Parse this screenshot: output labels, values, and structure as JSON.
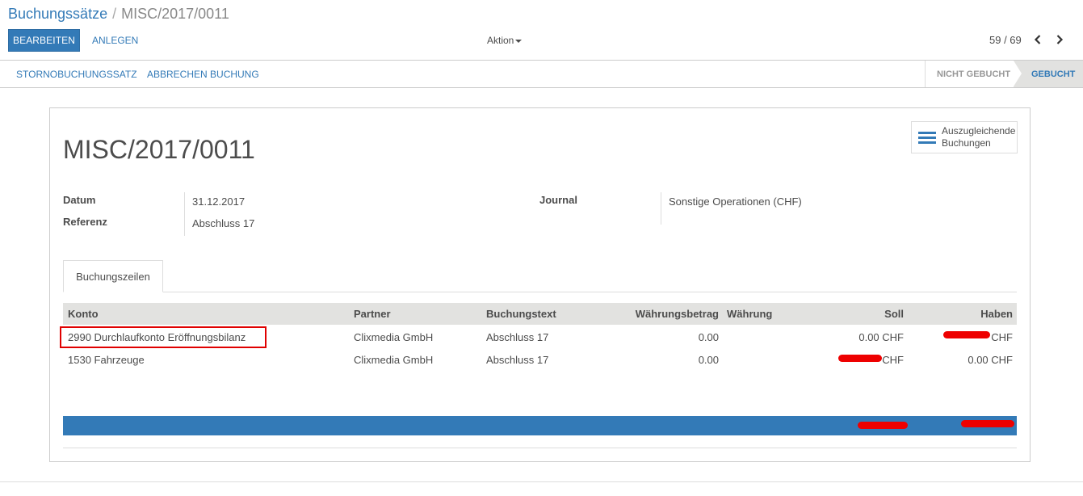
{
  "breadcrumb": {
    "parent": "Buchungssätze",
    "separator": "/",
    "current": "MISC/2017/0011"
  },
  "toolbar": {
    "edit_label": "BEARBEITEN",
    "create_label": "ANLEGEN",
    "action_label": "Aktion"
  },
  "pager": {
    "value": "59 / 69"
  },
  "statusbar": {
    "buttons": [
      "STORNOBUCHUNGSSATZ",
      "ABBRECHEN BUCHUNG"
    ],
    "states": [
      "NICHT GEBUCHT",
      "GEBUCHT"
    ],
    "active_state": "GEBUCHT"
  },
  "smart_button": {
    "line1": "Auszugleichende",
    "line2": "Buchungen"
  },
  "record": {
    "title": "MISC/2017/0011",
    "fields": {
      "datum_label": "Datum",
      "datum_value": "31.12.2017",
      "referenz_label": "Referenz",
      "referenz_value": "Abschluss 17",
      "journal_label": "Journal",
      "journal_value": "Sonstige Operationen (CHF)"
    }
  },
  "tabs": [
    "Buchungszeilen"
  ],
  "table": {
    "columns": [
      "Konto",
      "Partner",
      "Buchungstext",
      "Währungsbetrag",
      "Währung",
      "Soll",
      "Haben"
    ],
    "rows": [
      {
        "konto": "2990 Durchlaufkonto Eröffnungsbilanz",
        "partner": "Clixmedia GmbH",
        "text": "Abschluss 17",
        "betrag": "0.00",
        "waehrung": "",
        "soll": "0.00 CHF",
        "haben": "CHF"
      },
      {
        "konto": "1530 Fahrzeuge",
        "partner": "Clixmedia GmbH",
        "text": "Abschluss 17",
        "betrag": "0.00",
        "waehrung": "",
        "soll": "CHF",
        "haben": "0.00 CHF"
      }
    ]
  },
  "colors": {
    "primary": "#337ab7",
    "highlight": "#e00000",
    "redaction": "#ee0000"
  },
  "icons": {
    "pager_prev": "chevron-left-icon",
    "pager_next": "chevron-right-icon",
    "smart": "list-icon",
    "dropdown": "caret-down-icon"
  }
}
